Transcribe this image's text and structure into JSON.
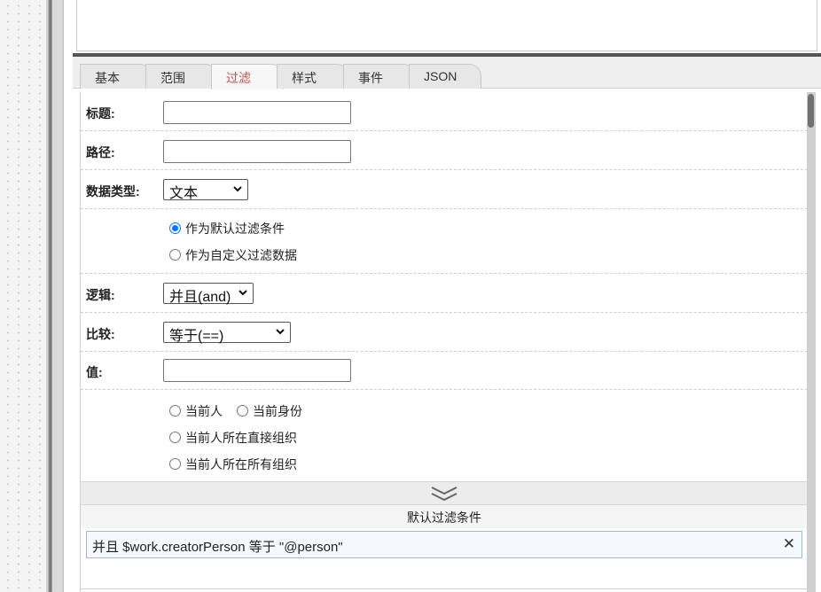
{
  "tabs": [
    {
      "label": "基本"
    },
    {
      "label": "范围"
    },
    {
      "label": "过滤"
    },
    {
      "label": "样式"
    },
    {
      "label": "事件"
    },
    {
      "label": "JSON"
    }
  ],
  "active_tab": "过滤",
  "form": {
    "title_label": "标题:",
    "title_value": "",
    "path_label": "路径:",
    "path_value": "",
    "data_type_label": "数据类型:",
    "data_type_value": "文本",
    "filter_mode_options": [
      {
        "label": "作为默认过滤条件",
        "checked": true
      },
      {
        "label": "作为自定义过滤数据",
        "checked": false
      }
    ],
    "logic_label": "逻辑:",
    "logic_value": "并且(and)",
    "compare_label": "比较:",
    "compare_value": "等于(==)",
    "value_label": "值:",
    "value_value": "",
    "value_options": [
      {
        "label": "当前人",
        "checked": false
      },
      {
        "label": "当前身份",
        "checked": false
      },
      {
        "label": "当前人所在直接组织",
        "checked": false
      },
      {
        "label": "当前人所在所有组织",
        "checked": false
      }
    ]
  },
  "summary": {
    "title": "默认过滤条件",
    "conditions": [
      {
        "text": "并且 $work.creatorPerson 等于 \"@person\""
      }
    ],
    "close_glyph": "✕"
  },
  "colors": {
    "active_tab": "#c0504d",
    "radio_checked": "#0075ff"
  }
}
